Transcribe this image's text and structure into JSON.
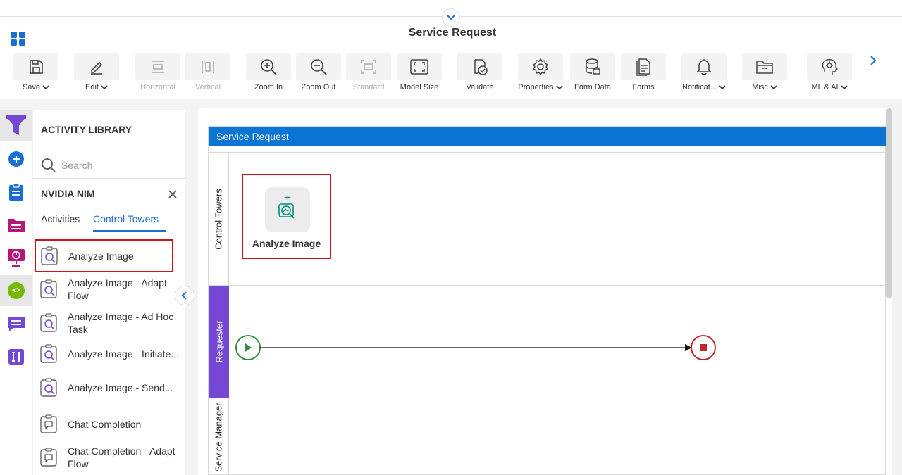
{
  "header": {
    "title": "Service Request"
  },
  "toolbar": {
    "save": "Save",
    "edit": "Edit",
    "horizontal": "Horizontal",
    "vertical": "Vertical",
    "zoom_in": "Zoom In",
    "zoom_out": "Zoom Out",
    "standard": "Standard",
    "model_size": "Model Size",
    "validate": "Validate",
    "properties": "Properties",
    "form_data": "Form Data",
    "forms": "Forms",
    "notifications": "Notificat...",
    "misc": "Misc",
    "ml_ai": "ML & AI"
  },
  "library": {
    "title": "ACTIVITY LIBRARY",
    "search_placeholder": "Search",
    "category": "NVIDIA NIM",
    "tabs": {
      "activities": "Activities",
      "control_towers": "Control Towers"
    },
    "items": [
      {
        "label": "Analyze Image"
      },
      {
        "label": "Analyze Image - Adapt Flow"
      },
      {
        "label": "Analyze Image - Ad Hoc Task"
      },
      {
        "label": "Analyze Image - Initiate..."
      },
      {
        "label": "Analyze Image - Send..."
      },
      {
        "label": "Chat Completion"
      },
      {
        "label": "Chat Completion - Adapt Flow"
      }
    ]
  },
  "canvas": {
    "pool_title": "Service Request",
    "lanes": [
      "Control Towers",
      "Requester",
      "Service Manager"
    ],
    "task_label": "Analyze Image"
  },
  "colors": {
    "accent": "#1a6fd1",
    "pool_header": "#0a75d4",
    "requester_lane": "#7447d4",
    "highlight": "#d0121b",
    "start_event": "#2e8b3e",
    "end_event": "#c0272d"
  }
}
